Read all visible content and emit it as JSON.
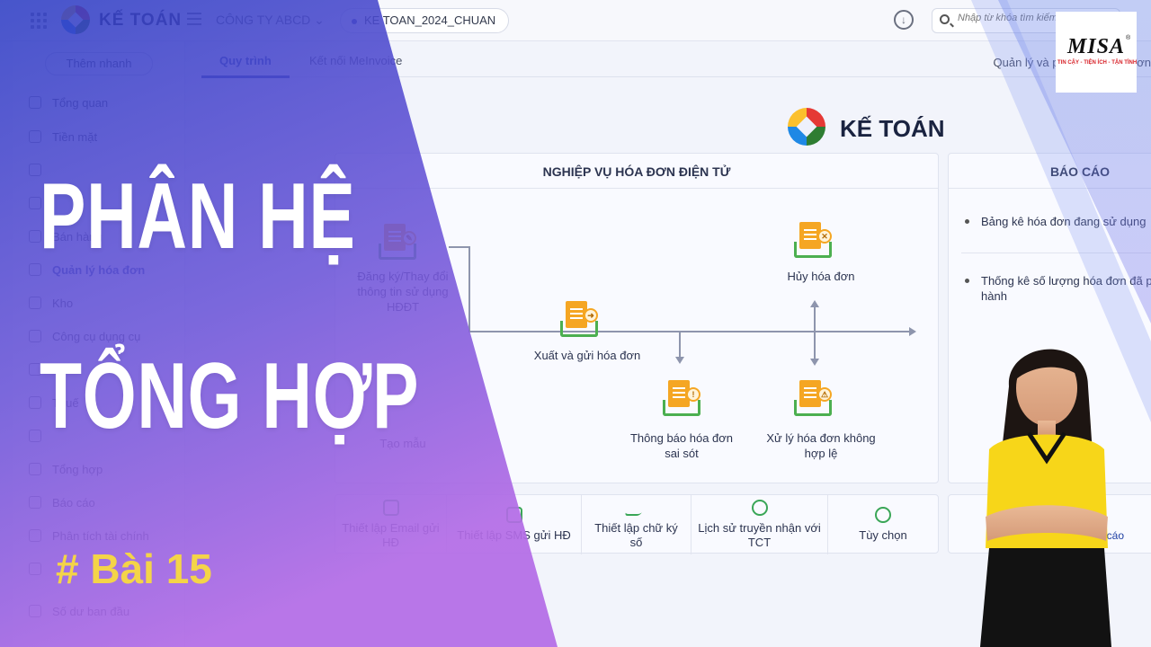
{
  "topbar": {
    "app_title": "KẾ TOÁN",
    "company": "CÔNG TY ABCD ⌄",
    "database": "KE TOAN_2024_CHUAN",
    "search_placeholder": "Nhập từ khóa tìm kiếm"
  },
  "sidebar": {
    "quick_add": "Thêm nhanh",
    "items": [
      "Tổng quan",
      "Tiền mặt",
      "",
      "",
      "Bán hàng",
      "Quản lý hóa đơn",
      "Kho",
      "Công cụ dụng cụ",
      "",
      "Thuế",
      "",
      "Tổng hợp",
      "Báo cáo",
      "Phân tích tài chính",
      "",
      "Số dư ban đầu"
    ]
  },
  "tabs": {
    "process": "Quy trình",
    "connect": "Kết nối MeInvoice",
    "right_link": "Quản lý và phát hành hóa đơn"
  },
  "brand": {
    "name": "KẾ TOÁN"
  },
  "invoice_card": {
    "title": "NGHIỆP VỤ HÓA ĐƠN ĐIỆN TỬ",
    "register": "Đăng ký/Thay đổi thông tin sử dụng HĐĐT",
    "template": "Tạo mẫu",
    "issue": "Xuất và gửi hóa đơn",
    "cancel": "Hủy hóa đơn",
    "notify_error": "Thông báo hóa đơn sai sót",
    "handle_invalid": "Xử lý hóa đơn không hợp lệ"
  },
  "report_card": {
    "title": "BÁO CÁO",
    "items": [
      "Bảng kê hóa đơn đang sử dụng",
      "Thống kê số lượng hóa đơn đã phát hành"
    ],
    "more": "Báo cáo"
  },
  "toolbar": {
    "email": "Thiết lập Email gửi HĐ",
    "sms": "Thiết lập SMS gửi HĐ",
    "signature": "Thiết lập chữ ký số",
    "history": "Lịch sử truyền nhận với TCT",
    "options": "Tùy chọn"
  },
  "headline": {
    "line1": "PHÂN HỆ",
    "line2": "TỔNG HỢP",
    "lesson": "# Bài 15"
  },
  "misa": {
    "wordmark": "MISA",
    "tagline": "TIN CẬY - TIỆN ÍCH - TẬN TÌNH",
    "reg": "®"
  },
  "colors": {
    "accent": "#1f3fa3",
    "banner_blue": "#3b3ec9",
    "banner_purple": "#a85ee0",
    "lesson_yellow": "#f4d448",
    "icon_orange": "#f5a623",
    "icon_green": "#4caf50"
  }
}
